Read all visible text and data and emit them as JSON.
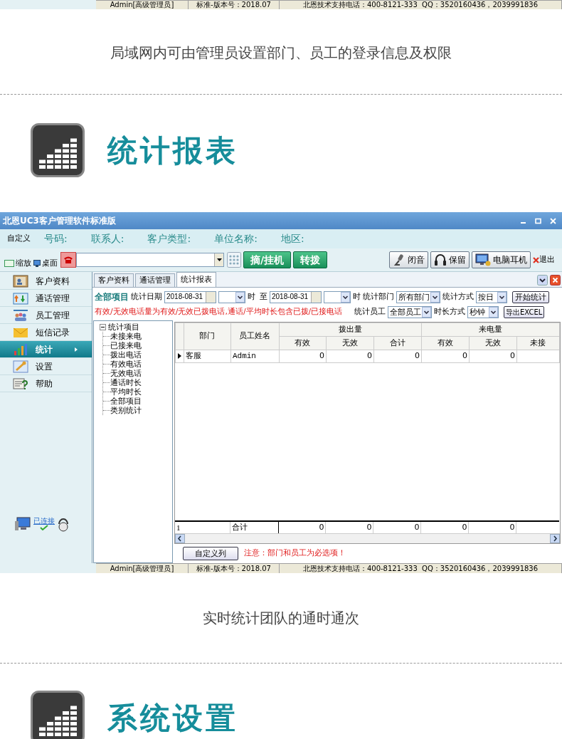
{
  "top_status_bar": [
    "Admin[高级管理员]",
    "标准-版本号：2018.07",
    "北恩技术支持电话：400-8121-333  QQ：3520160436，2039991836"
  ],
  "caption_1": "局域网内可由管理员设置部门、员工的登录信息及权限",
  "section_1": {
    "title": "统计报表"
  },
  "app": {
    "title": "北恩UC3客户管理软件标准版",
    "info_bar": {
      "customize": "自定义",
      "fields": [
        "号码:",
        "联系人:",
        "客户类型:",
        "单位名称:",
        "地区:"
      ]
    },
    "toolbar": {
      "zoom": "缩放",
      "desktop": "桌面",
      "dial_buttons": [
        "摘/挂机",
        "转拨"
      ],
      "right_buttons": [
        {
          "kind": "mic",
          "label": "闭音"
        },
        {
          "kind": "headphone",
          "label": "保留"
        },
        {
          "kind": "monitor",
          "label": "电脑耳机"
        }
      ],
      "exit": "退出"
    },
    "sidebar": {
      "items": [
        {
          "kind": "contacts",
          "label": "客户资料",
          "selected": false
        },
        {
          "kind": "calls",
          "label": "通话管理",
          "selected": false
        },
        {
          "kind": "staff",
          "label": "员工管理",
          "selected": false
        },
        {
          "kind": "mail",
          "label": "短信记录",
          "selected": false
        },
        {
          "kind": "chart",
          "label": "统计",
          "selected": true
        },
        {
          "kind": "settings",
          "label": "设置",
          "selected": false
        },
        {
          "kind": "help",
          "label": "帮助",
          "selected": false
        }
      ],
      "connection": "已连接"
    },
    "tabs": [
      {
        "label": "客户资料",
        "selected": false
      },
      {
        "label": "通话管理",
        "selected": false
      },
      {
        "label": "统计报表",
        "selected": true
      }
    ],
    "filters": {
      "all_items": "全部项目",
      "date_label": "统计日期",
      "date_from": "2018-08-31",
      "hour_1": "时",
      "to": "至",
      "date_to": "2018-08-31",
      "hour_2": "时",
      "dept_label": "统计部门",
      "dept": "所有部门",
      "method_label": "统计方式",
      "method": "按日",
      "start_button": "开始统计",
      "note": "有效/无效电话量为有效/无效已拨电话,通话/平均时长包含已拨/已接电话",
      "staff_label": "统计员工",
      "staff": "全部员工",
      "duration_label": "时长方式",
      "duration": "秒钟",
      "export_button": "导出EXCEL"
    },
    "tree": {
      "label": "统计项目",
      "expanded": true,
      "children": [
        {
          "label": "未接来电"
        },
        {
          "label": "已接来电"
        },
        {
          "label": "拨出电话"
        },
        {
          "label": "有效电话"
        },
        {
          "label": "无效电话"
        },
        {
          "label": "通话时长"
        },
        {
          "label": "平均时长"
        },
        {
          "label": "全部项目"
        },
        {
          "label": "类别统计"
        }
      ]
    },
    "table": {
      "columns": [
        "部门",
        "员工姓名"
      ],
      "groups": [
        {
          "label": "拨出量",
          "columns": [
            "有效",
            "无效",
            "合计"
          ]
        },
        {
          "label": "来电量",
          "columns": [
            "有效",
            "无效",
            "未接"
          ]
        }
      ],
      "rows": [
        {
          "current": true,
          "cells": [
            "客服",
            "Admin",
            "0",
            "0",
            "0",
            "0",
            "0"
          ]
        }
      ],
      "total_row": [
        "1",
        "合计",
        "0",
        "0",
        "0",
        "0",
        "0"
      ]
    },
    "customize_columns_button": "自定义列",
    "required_note": "注意：部门和员工为必选项！",
    "status_bar": [
      "Admin[高级管理员]",
      "标准-版本号：2018.07",
      "北恩技术支持电话：400-8121-333  QQ：3520160436，2039991836"
    ]
  },
  "caption_2": "实时统计团队的通时通次",
  "section_2": {
    "title": "系统设置"
  }
}
